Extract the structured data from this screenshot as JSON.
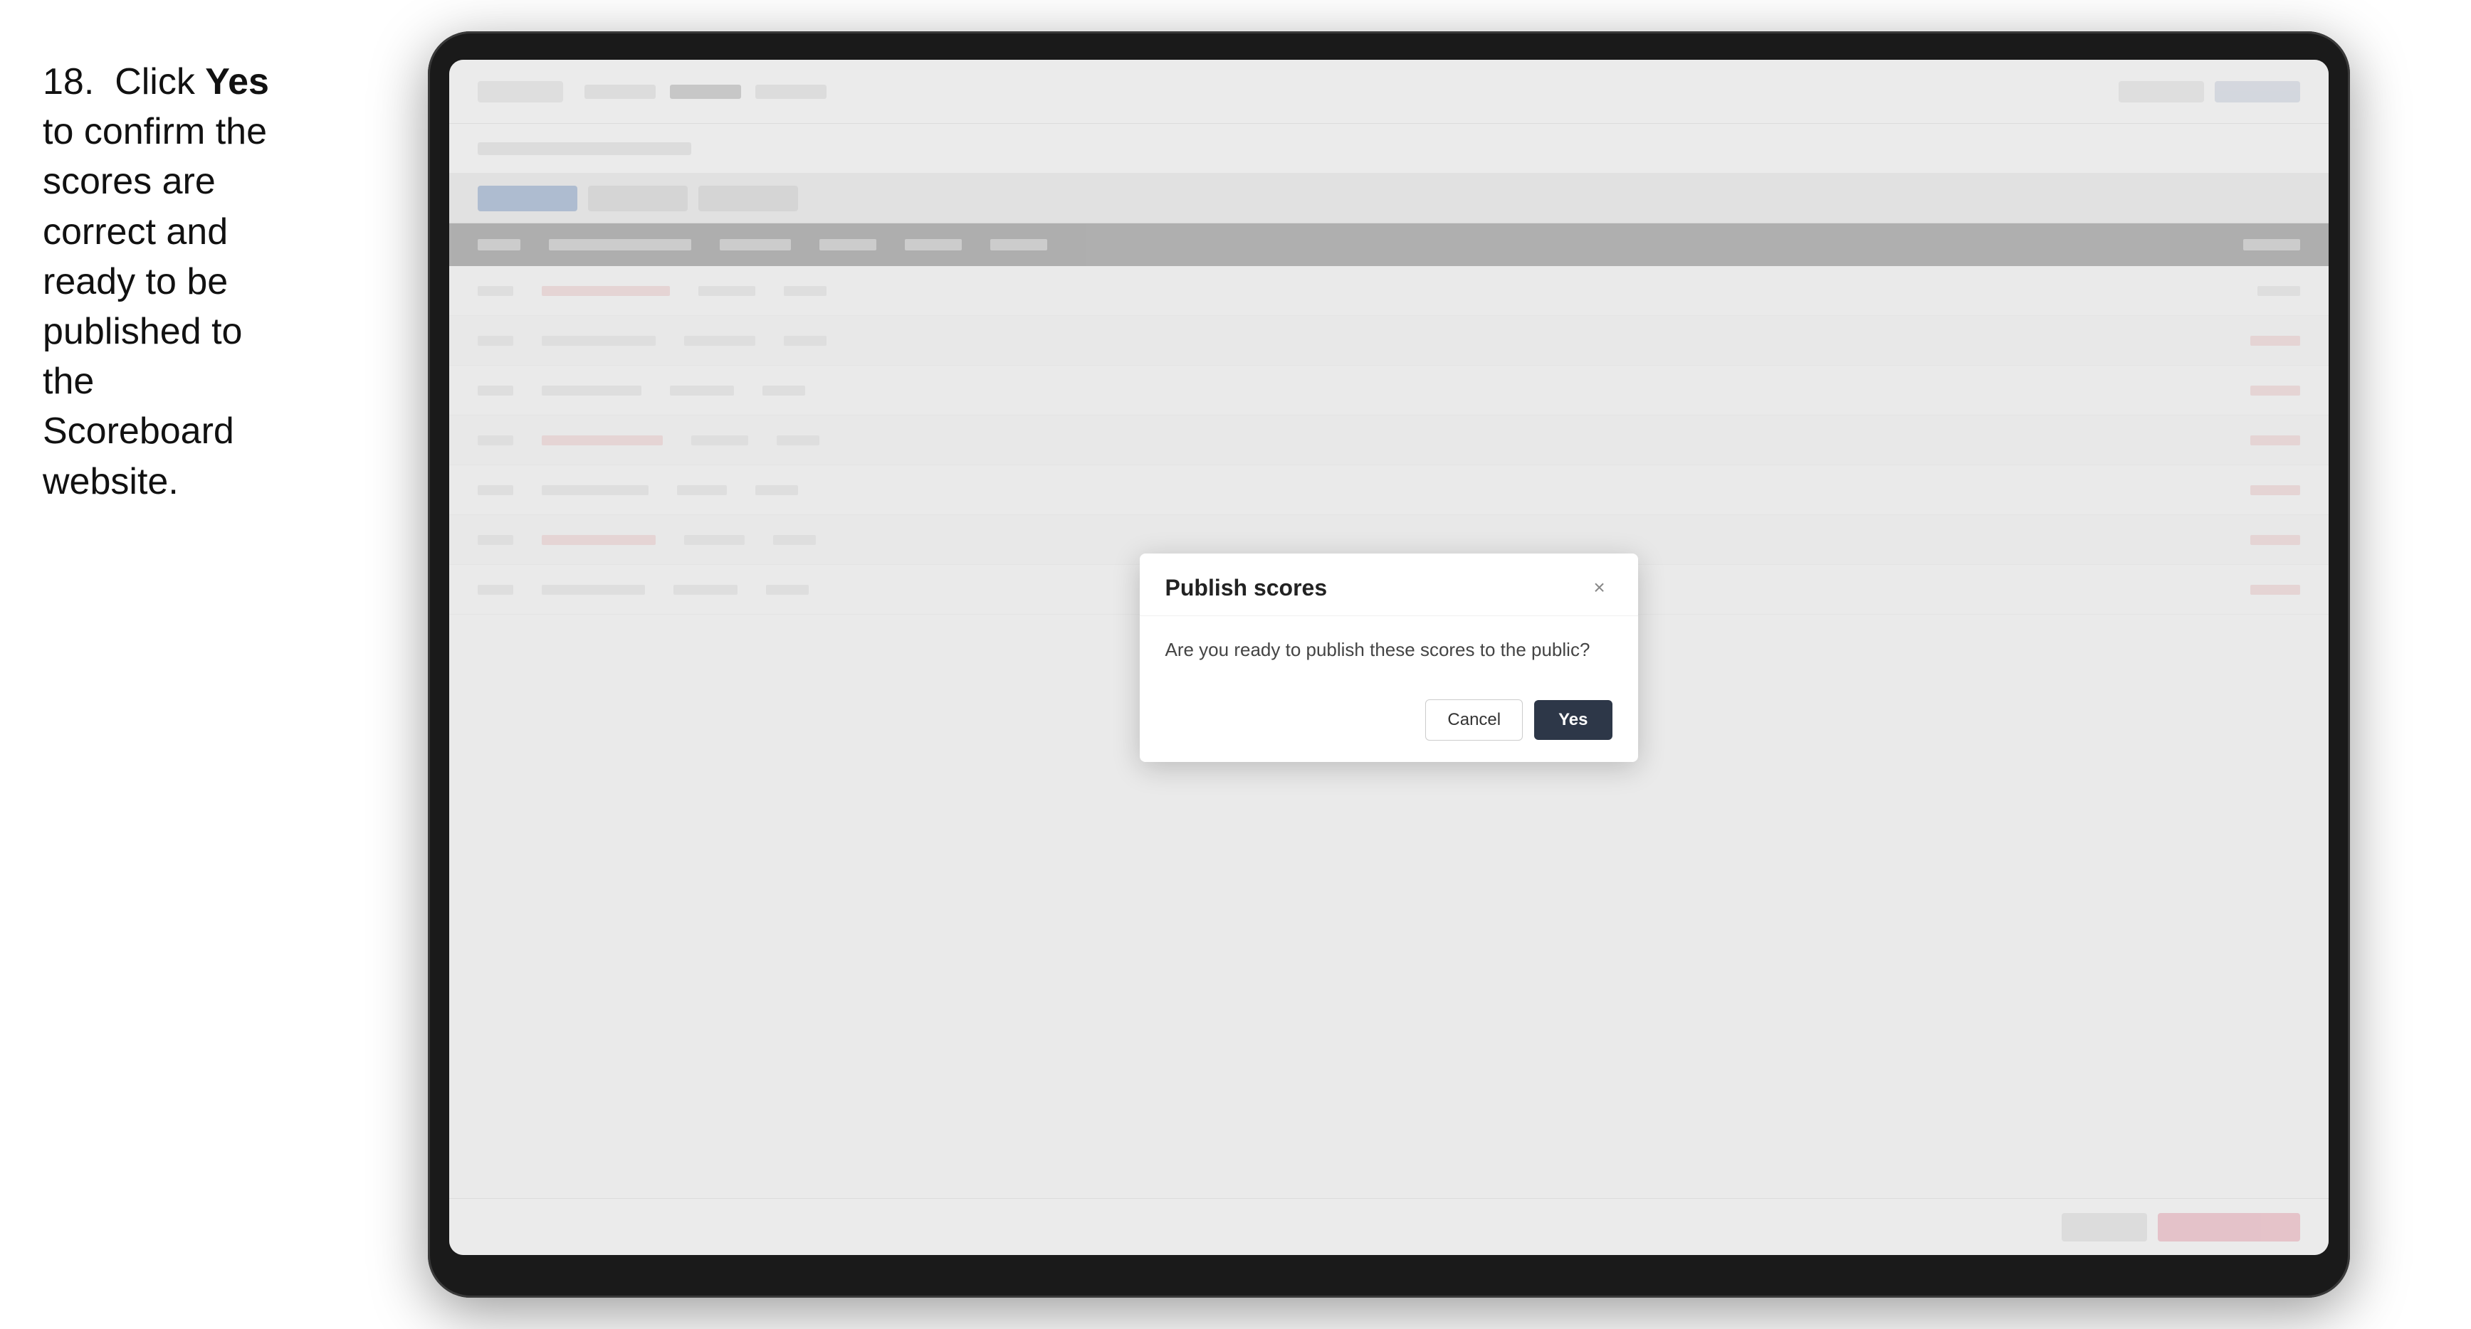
{
  "instruction": {
    "step_number": "18.",
    "text_parts": [
      "Click ",
      "Yes",
      " to confirm the scores are correct and ready to be published to the Scoreboard website."
    ]
  },
  "modal": {
    "title": "Publish scores",
    "body_text": "Are you ready to publish these scores to the public?",
    "cancel_label": "Cancel",
    "yes_label": "Yes",
    "close_icon": "×"
  },
  "colors": {
    "yes_button_bg": "#2d3748",
    "arrow_color": "#e83060"
  }
}
